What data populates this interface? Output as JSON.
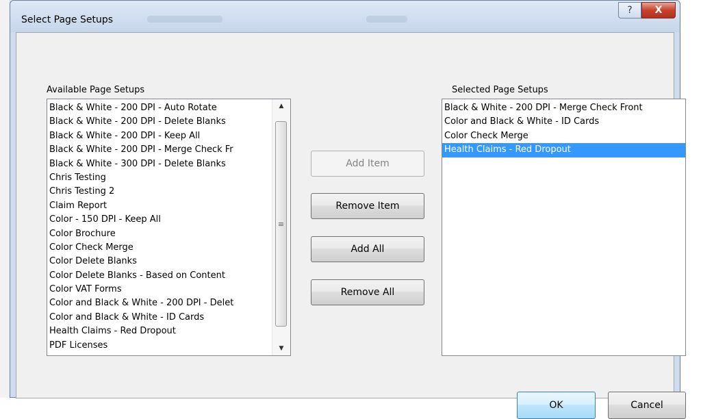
{
  "window": {
    "title": "Select Page Setups",
    "help_glyph": "?",
    "close_glyph": "X"
  },
  "available": {
    "label": "Available Page Setups",
    "items": [
      "Black & White - 200 DPI - Auto Rotate",
      "Black & White - 200 DPI - Delete Blanks",
      "Black & White - 200 DPI - Keep All",
      "Black & White - 200 DPI - Merge Check Fr",
      "Black & White - 300 DPI - Delete Blanks",
      "Chris Testing",
      "Chris Testing 2",
      "Claim Report",
      "Color - 150 DPI - Keep All",
      "Color Brochure",
      "Color Check Merge",
      "Color Delete Blanks",
      "Color Delete Blanks - Based on Content",
      "Color VAT Forms",
      "Color and Black & White - 200 DPI - Delet",
      "Color and Black & White - ID Cards",
      "Health Claims - Red Dropout",
      "PDF Licenses"
    ],
    "scroll_up_glyph": "▲",
    "scroll_down_glyph": "▼",
    "scroll_grip_glyph": "≡"
  },
  "selected": {
    "label": "Selected Page Setups",
    "items": [
      "Black & White - 200 DPI - Merge Check Front",
      "Color and Black & White - ID Cards",
      "Color Check Merge",
      "Health Claims - Red Dropout"
    ],
    "selected_index": 3
  },
  "buttons": {
    "add_item": "Add Item",
    "remove_item": "Remove Item",
    "add_all": "Add All",
    "remove_all": "Remove All",
    "ok": "OK",
    "cancel": "Cancel"
  },
  "colors": {
    "selection_bg": "#3399ff",
    "selection_fg": "#ffffff",
    "close_button": "#c7422e",
    "dialog_bg": "#f0f0f0"
  }
}
